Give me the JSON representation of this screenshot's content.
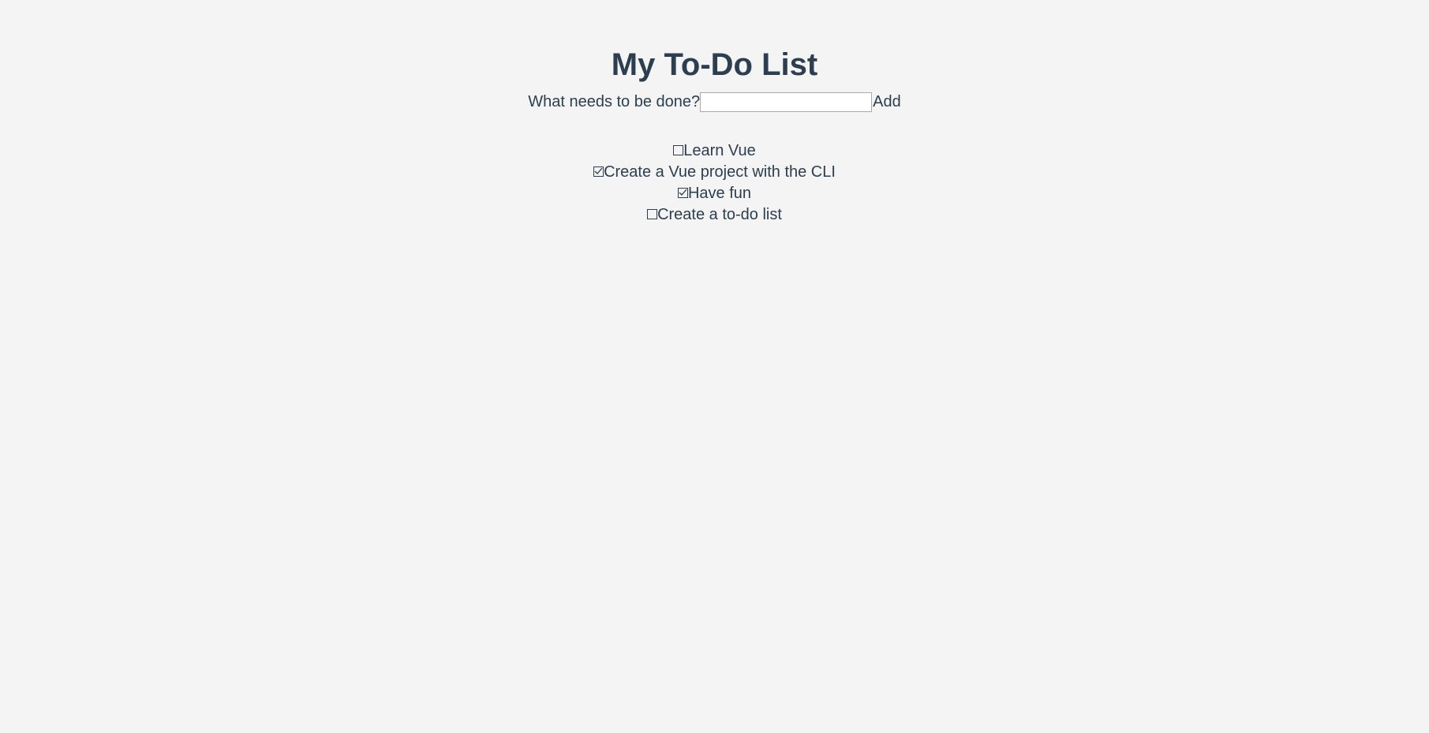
{
  "header": {
    "title": "My To-Do List"
  },
  "form": {
    "label": "What needs to be done?",
    "input_value": "",
    "add_label": "Add"
  },
  "todos": [
    {
      "label": "Learn Vue",
      "done": false
    },
    {
      "label": "Create a Vue project with the CLI",
      "done": true
    },
    {
      "label": "Have fun",
      "done": true
    },
    {
      "label": "Create a to-do list",
      "done": false
    }
  ]
}
